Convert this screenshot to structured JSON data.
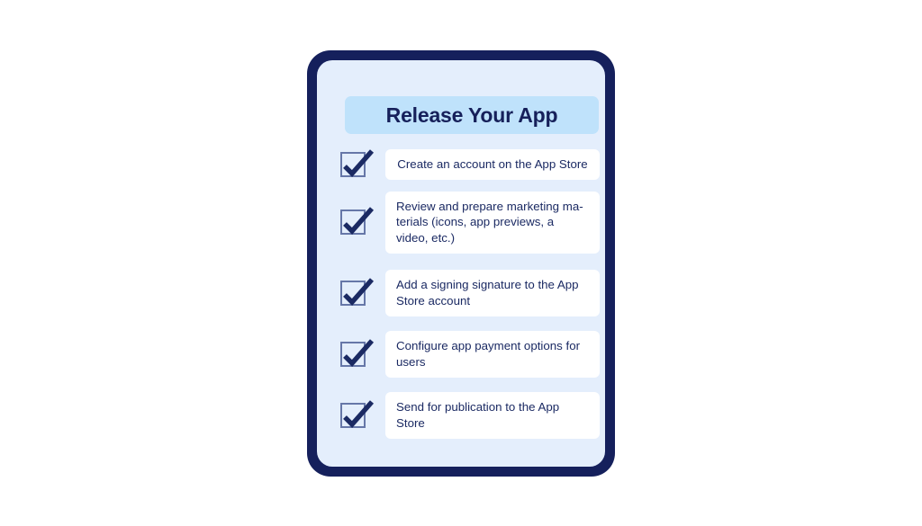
{
  "page": {
    "background_color": "#ffffff"
  },
  "device": {
    "frame_color": "#15205c",
    "screen_color": "#e4eefc"
  },
  "header": {
    "title": "Release Your App",
    "band_color": "#bfe2fb",
    "text_color": "#16205a"
  },
  "checklist": {
    "checkmark_color": "#1b2a63",
    "checkbox_border_color": "#6677a8",
    "card_color": "#ffffff",
    "items": [
      {
        "label": "Create an account on the App Store",
        "checked": true,
        "align": "centered",
        "icon": "checkmark-icon"
      },
      {
        "label": "Review and prepare marketing ma-terials (icons, app previews, a video, etc.)",
        "checked": true,
        "align": "left",
        "icon": "checkmark-icon"
      },
      {
        "label": "Add a signing signature to the App Store account",
        "checked": true,
        "align": "left",
        "icon": "checkmark-icon"
      },
      {
        "label": "Configure app payment options for users",
        "checked": true,
        "align": "left",
        "icon": "checkmark-icon"
      },
      {
        "label": "Send for publication to the App Store",
        "checked": true,
        "align": "left",
        "icon": "checkmark-icon"
      }
    ]
  }
}
